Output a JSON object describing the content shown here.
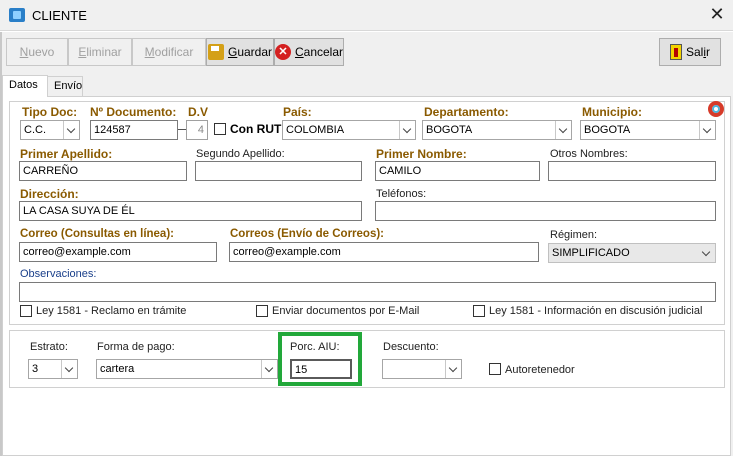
{
  "window": {
    "title": "CLIENTE",
    "close_glyph": "✕"
  },
  "toolbar": {
    "nuevo": {
      "accel": "N",
      "rest": "uevo"
    },
    "eliminar": {
      "accel": "E",
      "rest": "liminar"
    },
    "modificar": {
      "accel": "M",
      "rest": "odificar"
    },
    "guardar": {
      "accel": "G",
      "rest": "uardar"
    },
    "cancelar": {
      "accel": "C",
      "rest": "ancelar"
    },
    "salir": {
      "first": "Sal",
      "accel": "i",
      "rest": "r"
    }
  },
  "tabs": [
    "Datos",
    "Envío"
  ],
  "form": {
    "tipo_doc": {
      "label": "Tipo Doc:",
      "value": "C.C."
    },
    "num_doc": {
      "label": "Nº Documento:",
      "value": "124587"
    },
    "dv": {
      "label": "D.V",
      "value": "4"
    },
    "con_rut": {
      "label": "Con RUT",
      "checked": false
    },
    "pais": {
      "label": "País:",
      "value": "COLOMBIA"
    },
    "departamento": {
      "label": "Departamento:",
      "value": "BOGOTA"
    },
    "municipio": {
      "label": "Municipio:",
      "value": "BOGOTA"
    },
    "primer_apellido": {
      "label": "Primer Apellido:",
      "value": "CARREÑO"
    },
    "segundo_apellido": {
      "label": "Segundo Apellido:",
      "value": ""
    },
    "primer_nombre": {
      "label": "Primer Nombre:",
      "value": "CAMILO"
    },
    "otros_nombres": {
      "label": "Otros Nombres:",
      "value": ""
    },
    "direccion": {
      "label": "Dirección:",
      "value": "LA CASA SUYA DE ÉL"
    },
    "telefonos": {
      "label": "Teléfonos:",
      "value": ""
    },
    "correo_consultas": {
      "label": "Correo (Consultas en línea):",
      "value": "correo@example.com"
    },
    "correo_envio": {
      "label": "Correos (Envío de Correos):",
      "value": "correo@example.com"
    },
    "regimen": {
      "label": "Régimen:",
      "value": "SIMPLIFICADO"
    },
    "observaciones": {
      "label": "Observaciones:",
      "value": ""
    },
    "ley1581_reclamo": {
      "label": "Ley 1581 - Reclamo en trámite",
      "checked": false
    },
    "enviar_email": {
      "label": "Enviar documentos por E-Mail",
      "checked": false
    },
    "ley1581_info": {
      "label": "Ley 1581 - Información en discusión judicial",
      "checked": false
    }
  },
  "bottom": {
    "estrato": {
      "label": "Estrato:",
      "value": "3"
    },
    "forma_pago": {
      "label": "Forma de pago:",
      "value": "cartera"
    },
    "porc_aiu": {
      "label": "Porc. AIU:",
      "value": "15"
    },
    "descuento": {
      "label": "Descuento:",
      "value": ""
    },
    "autoretenedor": {
      "label": "Autoretenedor",
      "checked": false
    }
  },
  "colors": {
    "required_label": "#8a5a00",
    "highlight": "#22a83a"
  },
  "icons": [
    "app-icon",
    "close-icon",
    "save-icon",
    "cancel-icon",
    "exit-icon",
    "help-lifebuoy-icon"
  ]
}
